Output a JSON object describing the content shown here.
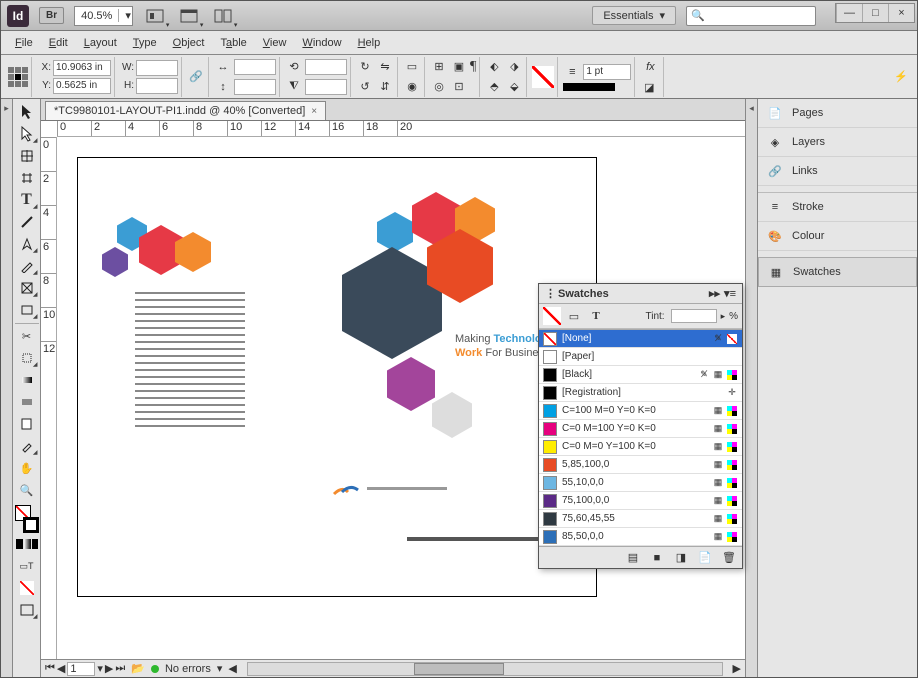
{
  "appbar": {
    "zoom": "40.5%",
    "workspace_preset": "Essentials",
    "search_icon": "search"
  },
  "window": {
    "minimize": "—",
    "maximize": "□",
    "close": "×"
  },
  "menus": [
    "File",
    "Edit",
    "Layout",
    "Type",
    "Object",
    "Table",
    "View",
    "Window",
    "Help"
  ],
  "controlbar": {
    "x_label": "X:",
    "x": "10.9063 in",
    "y_label": "Y:",
    "y": "0.5625 in",
    "w_label": "W:",
    "w": "",
    "h_label": "H:",
    "h": "",
    "stroke_wt": "1 pt"
  },
  "tab": {
    "title": "*TC9980101-LAYOUT-PI1.indd @ 40% [Converted]"
  },
  "ruler_h": [
    "0",
    "2",
    "4",
    "6",
    "8",
    "10",
    "12",
    "14",
    "16",
    "18",
    "20"
  ],
  "ruler_v": [
    "0",
    "2",
    "4",
    "6",
    "8",
    "10",
    "12"
  ],
  "doc": {
    "tagline_a": "Making ",
    "tagline_b": "Technology",
    "tagline_c": "Work ",
    "tagline_d": "For Business"
  },
  "swatches": {
    "title": "Swatches",
    "tint_label": "Tint:",
    "tint_unit": "%",
    "items": [
      {
        "name": "[None]",
        "chip": "none",
        "sel": true,
        "lock": true,
        "none": true
      },
      {
        "name": "[Paper]",
        "chip": "#ffffff"
      },
      {
        "name": "[Black]",
        "chip": "#000000",
        "lock": true,
        "proc": true
      },
      {
        "name": "[Registration]",
        "chip": "reg",
        "reg": true
      },
      {
        "name": "C=100 M=0 Y=0 K=0",
        "chip": "#00a0e3",
        "proc": true
      },
      {
        "name": "C=0 M=100 Y=0 K=0",
        "chip": "#e6007e",
        "proc": true
      },
      {
        "name": "C=0 M=0 Y=100 K=0",
        "chip": "#ffed00",
        "proc": true
      },
      {
        "name": "5,85,100,0",
        "chip": "#e84b24",
        "proc": true
      },
      {
        "name": "55,10,0,0",
        "chip": "#6db6e2",
        "proc": true
      },
      {
        "name": "75,100,0,0",
        "chip": "#5b2a86",
        "proc": true
      },
      {
        "name": "75,60,45,55",
        "chip": "#2f3a42",
        "proc": true
      },
      {
        "name": "85,50,0,0",
        "chip": "#2c6fb7",
        "proc": true
      }
    ]
  },
  "rightdock": [
    "Pages",
    "Layers",
    "Links",
    "Stroke",
    "Colour",
    "Swatches"
  ],
  "status": {
    "page": "1",
    "errors": "No errors"
  }
}
